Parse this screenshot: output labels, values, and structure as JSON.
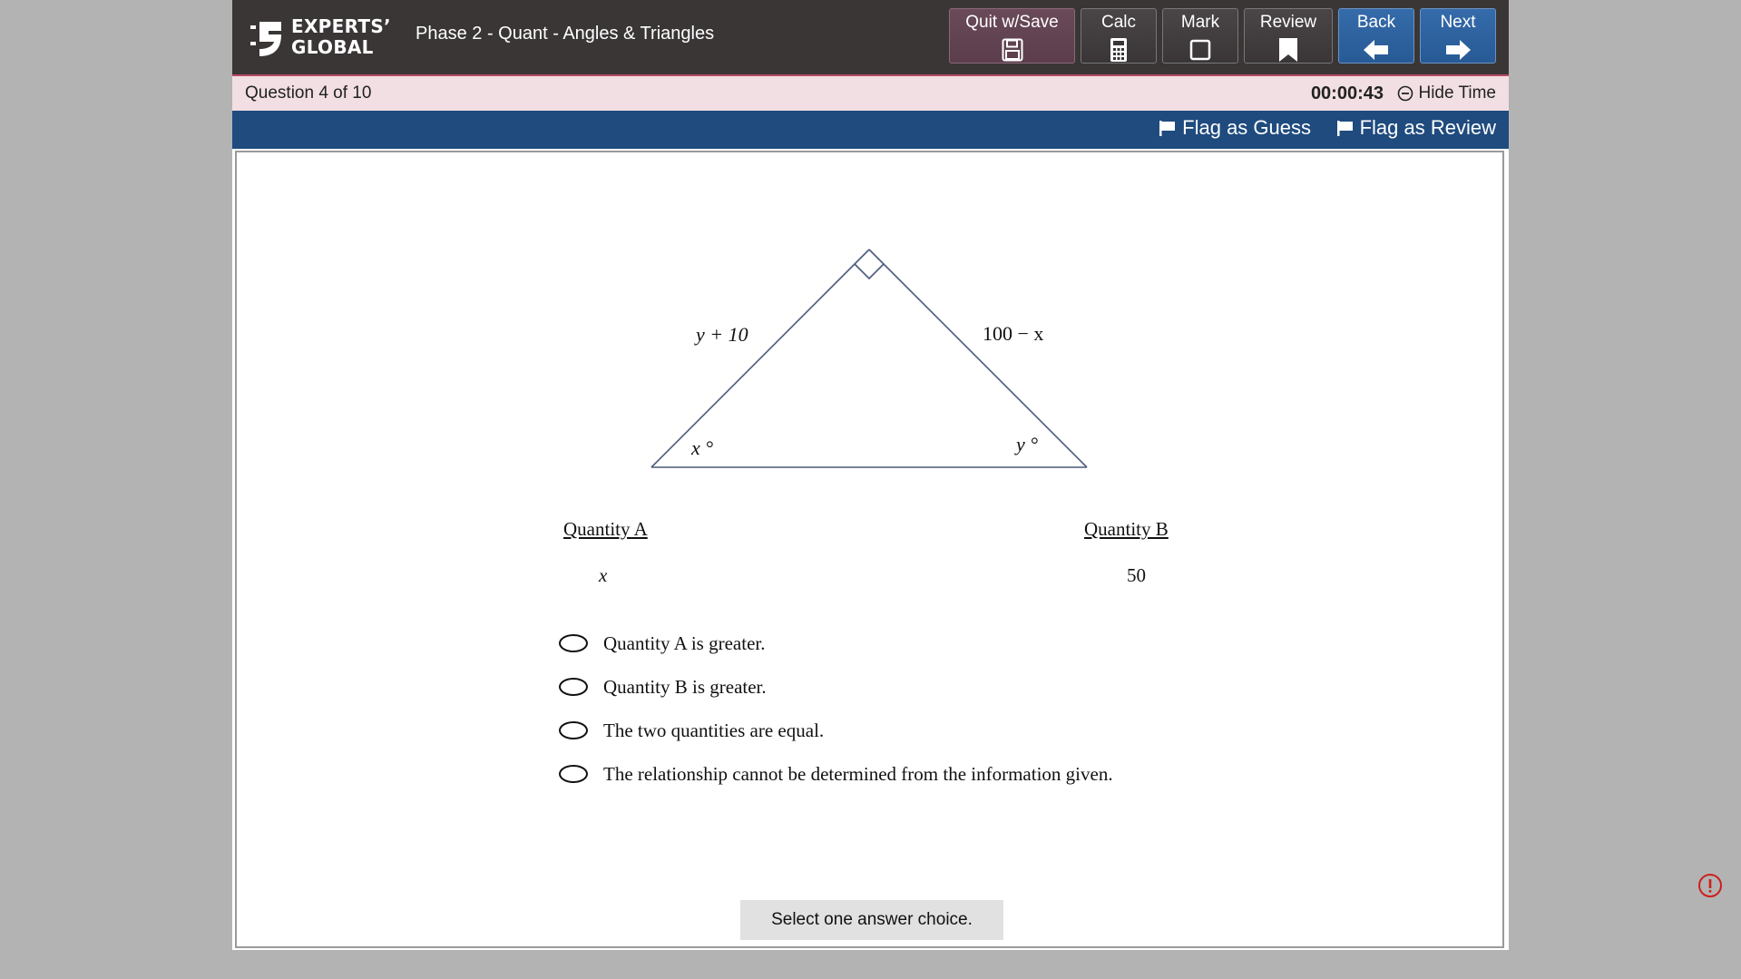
{
  "brand": {
    "line1": "EXPERTS’",
    "line2": "GLOBAL"
  },
  "header": {
    "test_title": "Phase 2 - Quant - Angles & Triangles"
  },
  "toolbar": {
    "quit_label": "Quit w/Save",
    "calc_label": "Calc",
    "mark_label": "Mark",
    "review_label": "Review",
    "back_label": "Back",
    "next_label": "Next"
  },
  "status": {
    "question_count": "Question 4 of 10",
    "timer": "00:00:43",
    "hide_time_label": "Hide Time"
  },
  "flags": {
    "guess_label": "Flag as Guess",
    "review_label": "Flag as Review"
  },
  "figure": {
    "left_side": "y + 10",
    "right_side": "100 − x",
    "angle_left": "x °",
    "angle_right": "y °"
  },
  "quantities": {
    "a_heading": "Quantity A",
    "a_value": "x",
    "b_heading": "Quantity B",
    "b_value": "50"
  },
  "choices": [
    "Quantity A is greater.",
    "Quantity B is greater.",
    "The two quantities are equal.",
    "The relationship cannot be determined from the information given."
  ],
  "hint": "Select one answer choice.",
  "colors": {
    "header_bg": "#3a3636",
    "status_bg": "#f2dfe3",
    "flagbar_bg": "#1f4b7e",
    "quit_bg": "#5b3d4b",
    "nav_blue": "#275a95",
    "figure_line": "#4a5a7a"
  }
}
